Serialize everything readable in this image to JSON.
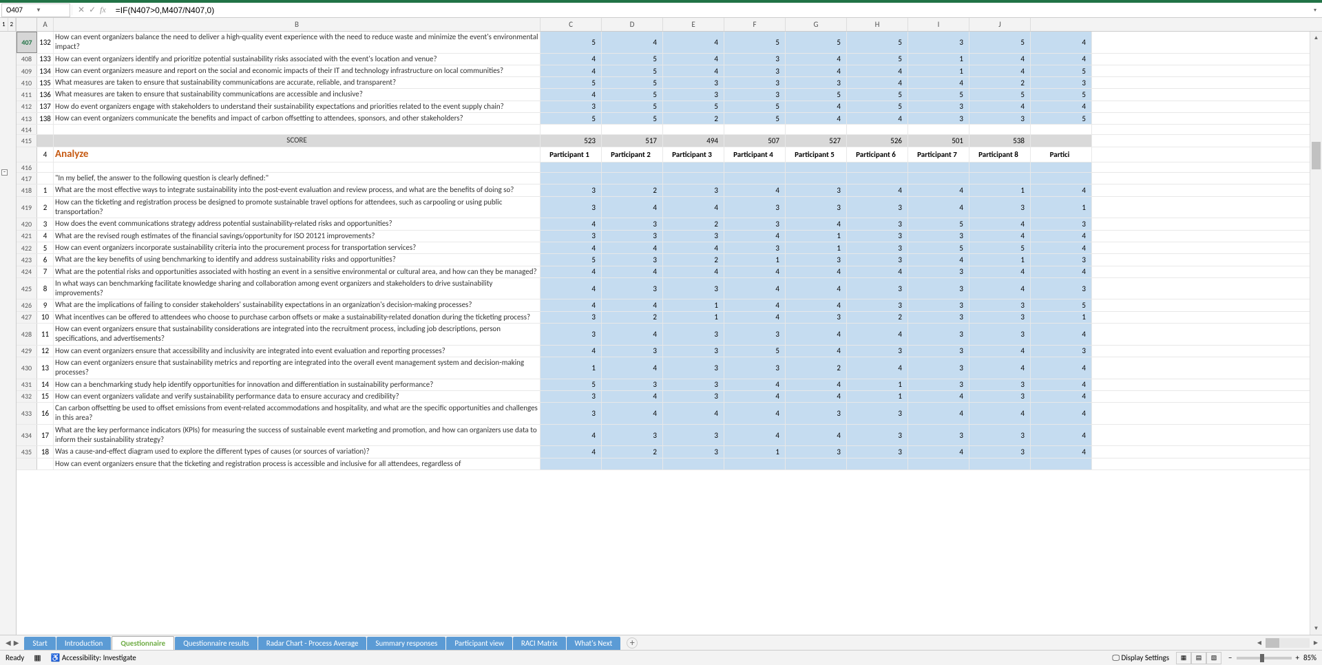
{
  "namebox": "O407",
  "formula": "=IF(N407>0,M407/N407,0)",
  "outline_levels": [
    "1",
    "2"
  ],
  "col_A_width": 24,
  "columns": [
    "A",
    "B",
    "C",
    "D",
    "E",
    "F",
    "G",
    "H",
    "I",
    "J"
  ],
  "rows": [
    {
      "rh": "407",
      "a": "132",
      "b": "How can event organizers balance the need to deliver a high-quality event experience with the need to reduce waste and minimize the event's environmental impact?",
      "v": [
        5,
        4,
        4,
        5,
        5,
        5,
        3,
        5,
        4
      ],
      "blue": true,
      "active": true
    },
    {
      "rh": "408",
      "a": "133",
      "b": "How can event organizers identify and prioritize potential sustainability risks associated with the event's location and venue?",
      "v": [
        4,
        5,
        4,
        3,
        4,
        5,
        1,
        4,
        4
      ],
      "blue": true
    },
    {
      "rh": "409",
      "a": "134",
      "b": "How can event organizers measure and report on the social and economic impacts of their IT and technology infrastructure on local communities?",
      "v": [
        4,
        5,
        4,
        3,
        4,
        4,
        1,
        4,
        5
      ],
      "blue": true
    },
    {
      "rh": "410",
      "a": "135",
      "b": "What measures are taken to ensure that sustainability communications are accurate, reliable, and transparent?",
      "v": [
        5,
        5,
        3,
        3,
        3,
        4,
        4,
        2,
        3
      ],
      "blue": true
    },
    {
      "rh": "411",
      "a": "136",
      "b": "What measures are taken to ensure that sustainability communications are accessible and inclusive?",
      "v": [
        4,
        5,
        3,
        3,
        5,
        5,
        5,
        5,
        5
      ],
      "blue": true
    },
    {
      "rh": "412",
      "a": "137",
      "b": "How do event organizers engage with stakeholders to understand their sustainability expectations and priorities related to the event supply chain?",
      "v": [
        3,
        5,
        5,
        5,
        4,
        5,
        3,
        4,
        4
      ],
      "blue": true
    },
    {
      "rh": "413",
      "a": "138",
      "b": "How can event organizers communicate the benefits and impact of carbon offsetting to attendees, sponsors, and other stakeholders?",
      "v": [
        5,
        5,
        2,
        5,
        4,
        4,
        3,
        3,
        5
      ],
      "blue": true
    },
    {
      "rh": "414",
      "a": "",
      "b": "",
      "v": [
        "",
        "",
        "",
        "",
        "",
        "",
        "",
        "",
        ""
      ],
      "blue": false
    },
    {
      "rh": "415",
      "a": "",
      "b": "SCORE",
      "v": [
        523,
        517,
        494,
        507,
        527,
        526,
        501,
        538,
        ""
      ],
      "grey": true
    },
    {
      "rh": "",
      "a": "4",
      "b": "Analyze",
      "heading": true,
      "participants": [
        "Participant 1",
        "Participant 2",
        "Participant 3",
        "Participant 4",
        "Participant 5",
        "Participant 6",
        "Participant 7",
        "Participant 8",
        "Partici"
      ]
    },
    {
      "rh": "416",
      "a": "",
      "b": "",
      "v": [
        "",
        "",
        "",
        "",
        "",
        "",
        "",
        "",
        ""
      ],
      "blue": true
    },
    {
      "rh": "417",
      "a": "",
      "b": "\"In my belief, the answer to the following question is clearly defined:\"",
      "v": [
        "",
        "",
        "",
        "",
        "",
        "",
        "",
        "",
        ""
      ],
      "blue": true,
      "quote": true
    },
    {
      "rh": "418",
      "a": "1",
      "b": "What are the most effective ways to integrate sustainability into the post-event evaluation and review process, and what are the benefits of doing so?",
      "v": [
        3,
        2,
        3,
        4,
        3,
        4,
        4,
        1,
        4
      ],
      "blue": true
    },
    {
      "rh": "419",
      "a": "2",
      "b": "How can the ticketing and registration process be designed to promote sustainable travel options for attendees, such as carpooling or using public transportation?",
      "v": [
        3,
        4,
        4,
        3,
        3,
        3,
        4,
        3,
        1
      ],
      "blue": true
    },
    {
      "rh": "420",
      "a": "3",
      "b": "How does the event communications strategy address potential sustainability-related risks and opportunities?",
      "v": [
        4,
        3,
        2,
        3,
        4,
        3,
        5,
        4,
        3
      ],
      "blue": true
    },
    {
      "rh": "421",
      "a": "4",
      "b": "What are the revised rough estimates of the financial savings/opportunity for ISO 20121 improvements?",
      "v": [
        3,
        3,
        3,
        4,
        1,
        3,
        3,
        4,
        4
      ],
      "blue": true
    },
    {
      "rh": "422",
      "a": "5",
      "b": "How can event organizers incorporate sustainability criteria into the procurement process for transportation services?",
      "v": [
        4,
        4,
        4,
        3,
        1,
        3,
        5,
        5,
        4
      ],
      "blue": true
    },
    {
      "rh": "423",
      "a": "6",
      "b": "What are the key benefits of using benchmarking to identify and address sustainability risks and opportunities?",
      "v": [
        5,
        3,
        2,
        1,
        3,
        3,
        4,
        1,
        3
      ],
      "blue": true
    },
    {
      "rh": "424",
      "a": "7",
      "b": "What are the potential risks and opportunities associated with hosting an event in a sensitive environmental or cultural area, and how can they be managed?",
      "v": [
        4,
        4,
        4,
        4,
        4,
        4,
        3,
        4,
        4
      ],
      "blue": true
    },
    {
      "rh": "425",
      "a": "8",
      "b": "In what ways can benchmarking facilitate knowledge sharing and collaboration among event organizers and stakeholders to drive sustainability improvements?",
      "v": [
        4,
        3,
        3,
        4,
        4,
        3,
        3,
        4,
        3
      ],
      "blue": true
    },
    {
      "rh": "426",
      "a": "9",
      "b": "What are the implications of failing to consider stakeholders' sustainability expectations in an organization's decision-making processes?",
      "v": [
        4,
        4,
        1,
        4,
        4,
        3,
        3,
        3,
        5
      ],
      "blue": true
    },
    {
      "rh": "427",
      "a": "10",
      "b": "What incentives can be offered to attendees who choose to purchase carbon offsets or make a sustainability-related donation during the ticketing process?",
      "v": [
        3,
        2,
        1,
        4,
        3,
        2,
        3,
        3,
        1
      ],
      "blue": true
    },
    {
      "rh": "428",
      "a": "11",
      "b": "How can event organizers ensure that sustainability considerations are integrated into the recruitment process, including job descriptions, person specifications, and advertisements?",
      "v": [
        3,
        4,
        3,
        3,
        4,
        4,
        3,
        3,
        4
      ],
      "blue": true
    },
    {
      "rh": "429",
      "a": "12",
      "b": "How can event organizers ensure that accessibility and inclusivity are integrated into event evaluation and reporting processes?",
      "v": [
        4,
        3,
        3,
        5,
        4,
        3,
        3,
        4,
        3
      ],
      "blue": true
    },
    {
      "rh": "430",
      "a": "13",
      "b": "How can event organizers ensure that sustainability metrics and reporting are integrated into the overall event management system and decision-making processes?",
      "v": [
        1,
        4,
        3,
        3,
        2,
        4,
        3,
        4,
        4
      ],
      "blue": true
    },
    {
      "rh": "431",
      "a": "14",
      "b": "How can a benchmarking study help identify opportunities for innovation and differentiation in sustainability performance?",
      "v": [
        5,
        3,
        3,
        4,
        4,
        1,
        3,
        3,
        4
      ],
      "blue": true
    },
    {
      "rh": "432",
      "a": "15",
      "b": "How can event organizers validate and verify sustainability performance data to ensure accuracy and credibility?",
      "v": [
        3,
        4,
        3,
        4,
        4,
        1,
        4,
        3,
        4
      ],
      "blue": true
    },
    {
      "rh": "433",
      "a": "16",
      "b": "Can carbon offsetting be used to offset emissions from event-related accommodations and hospitality, and what are the specific opportunities and challenges in this area?",
      "v": [
        3,
        4,
        4,
        4,
        3,
        3,
        4,
        4,
        4
      ],
      "blue": true
    },
    {
      "rh": "434",
      "a": "17",
      "b": "What are the key performance indicators (KPIs) for measuring the success of sustainable event marketing and promotion, and how can organizers use data to inform their sustainability strategy?",
      "v": [
        4,
        3,
        3,
        4,
        4,
        3,
        3,
        3,
        4
      ],
      "blue": true
    },
    {
      "rh": "435",
      "a": "18",
      "b": "Was a cause-and-effect diagram used to explore the different types of causes (or sources of variation)?",
      "v": [
        4,
        2,
        3,
        1,
        3,
        3,
        4,
        3,
        4
      ],
      "blue": true
    },
    {
      "rh": "",
      "a": "",
      "b": "How can event organizers ensure that the ticketing and registration process is accessible and inclusive for all attendees, regardless of",
      "v": [
        "",
        "",
        "",
        "",
        "",
        "",
        "",
        "",
        ""
      ],
      "blue": true,
      "partial": true
    }
  ],
  "tabs": [
    "Start",
    "Introduction",
    "Questionnaire",
    "Questionnaire results",
    "Radar Chart - Process Average",
    "Summary responses",
    "Participant view",
    "RACI Matrix",
    "What's Next"
  ],
  "active_tab": 2,
  "status_ready": "Ready",
  "status_accessibility": "Accessibility: Investigate",
  "display_settings": "Display Settings",
  "zoom_pct": "85%"
}
